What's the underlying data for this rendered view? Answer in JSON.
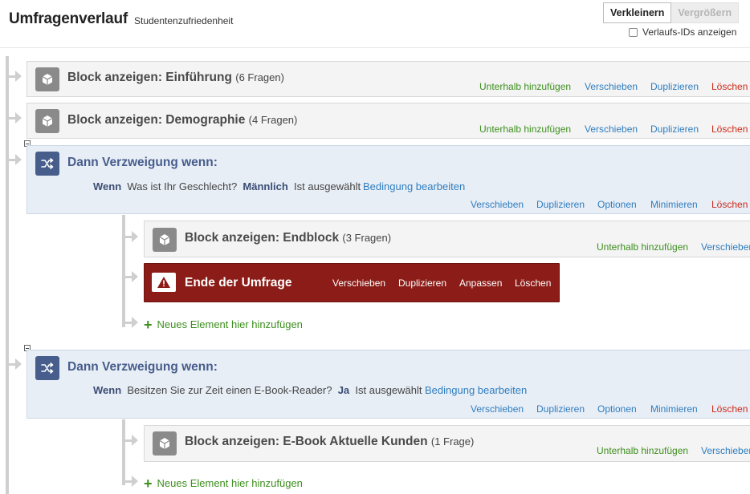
{
  "header": {
    "title": "Umfragenverlauf",
    "subtitle": "Studentenzufriedenheit",
    "shrink_label": "Verkleinern",
    "grow_label": "Vergrößern",
    "show_ids_label": "Verlaufs-IDs anzeigen"
  },
  "block1": {
    "title": "Block anzeigen: Einführung",
    "count": "(6 Fragen)",
    "actions": [
      "Unterhalb hinzufügen",
      "Verschieben",
      "Duplizieren",
      "Löschen"
    ]
  },
  "block2": {
    "title": "Block anzeigen: Demographie",
    "count": "(4 Fragen)",
    "actions": [
      "Unterhalb hinzufügen",
      "Verschieben",
      "Duplizieren",
      "Löschen"
    ]
  },
  "branch1": {
    "title": "Dann Verzweigung wenn:",
    "cond_if": "Wenn",
    "cond_question": "Was ist Ihr Geschlecht?",
    "cond_answer": "Männlich",
    "cond_state": "Ist ausgewählt",
    "cond_edit": "Bedingung bearbeiten",
    "actions": [
      "Verschieben",
      "Duplizieren",
      "Optionen",
      "Minimieren",
      "Löschen"
    ],
    "block": {
      "title": "Block anzeigen: Endblock",
      "count": "(3 Fragen)",
      "actions": [
        "Unterhalb hinzufügen",
        "Verschieben"
      ]
    },
    "end": {
      "title": "Ende der Umfrage",
      "actions": [
        "Verschieben",
        "Duplizieren",
        "Anpassen",
        "Löschen"
      ]
    },
    "add_new": "Neues Element hier hinzufügen"
  },
  "branch2": {
    "title": "Dann Verzweigung wenn:",
    "cond_if": "Wenn",
    "cond_question": "Besitzen Sie zur Zeit einen E-Book-Reader?",
    "cond_answer": "Ja",
    "cond_state": "Ist ausgewählt",
    "cond_edit": "Bedingung bearbeiten",
    "actions": [
      "Verschieben",
      "Duplizieren",
      "Optionen",
      "Minimieren",
      "Löschen"
    ],
    "block": {
      "title": "Block anzeigen: E-Book Aktuelle Kunden",
      "count": "(1 Frage)",
      "actions": [
        "Unterhalb hinzufügen",
        "Verschieben"
      ]
    },
    "add_new": "Neues Element hier hinzufügen"
  },
  "colors": {
    "accent_green": "#3d8f1e",
    "link_blue": "#2f7dbf",
    "delete_red": "#cc2a1a",
    "branch_navy": "#475d8c",
    "end_red": "#8b1c17"
  }
}
